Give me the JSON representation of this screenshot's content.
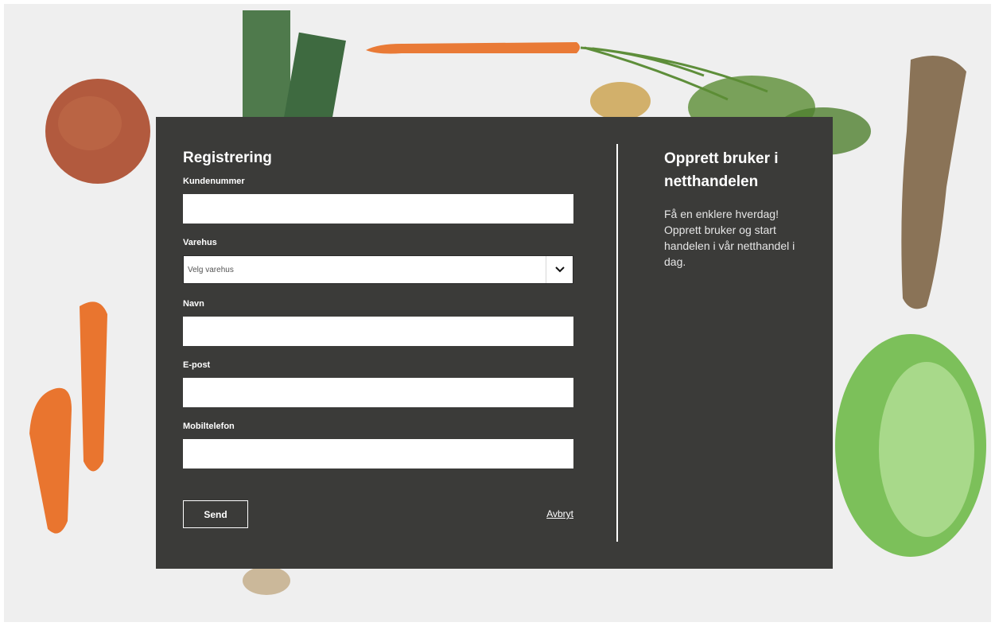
{
  "form": {
    "title": "Registrering",
    "fields": {
      "customer_number": {
        "label": "Kundenummer",
        "value": ""
      },
      "store": {
        "label": "Varehus",
        "selected": "Velg varehus"
      },
      "name": {
        "label": "Navn",
        "value": ""
      },
      "email": {
        "label": "E-post",
        "value": ""
      },
      "mobile": {
        "label": "Mobiltelefon",
        "value": ""
      }
    },
    "send_label": "Send",
    "cancel_label": "Avbryt"
  },
  "info": {
    "title": "Opprett bruker i netthandelen",
    "text": "Få en enklere hverdag! Opprett bruker og start handelen i vår netthandel i dag."
  },
  "icons": {
    "select_arrow": "chevron-down-icon"
  },
  "colors": {
    "panel": "#3b3b39",
    "background": "#efefef",
    "text": "#ffffff"
  }
}
